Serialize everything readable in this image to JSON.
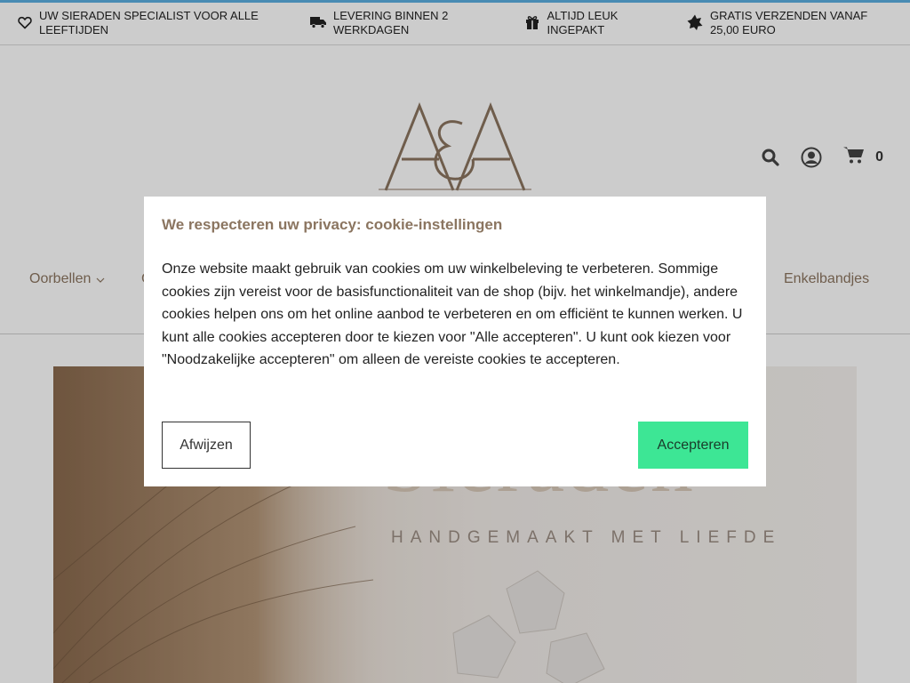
{
  "usp_bar": {
    "items": [
      {
        "icon": "heart-icon",
        "text": "UW SIERADEN SPECIALIST VOOR ALLE LEEFTIJDEN"
      },
      {
        "icon": "truck-icon",
        "text": "LEVERING BINNEN 2 WERKDAGEN"
      },
      {
        "icon": "gift-icon",
        "text": "ALTIJD LEUK INGEPAKT"
      },
      {
        "icon": "star-badge-icon",
        "text": "GRATIS VERZENDEN VANAF 25,00 EURO"
      }
    ]
  },
  "header": {
    "logo_text": "A&A",
    "icons": [
      "search-icon",
      "user-circle-icon",
      "cart-icon"
    ],
    "cart_count": "0"
  },
  "nav": {
    "items": [
      {
        "label": "Oorbellen",
        "has_dropdown": true
      },
      {
        "label": "C",
        "has_dropdown": false
      },
      {
        "label": "Enkelbandjes",
        "has_dropdown": false
      }
    ]
  },
  "hero": {
    "title": "Sieraden",
    "subtitle": "HANDGEMAAKT MET LIEFDE"
  },
  "cookie_modal": {
    "title": "We respecteren uw privacy: cookie-instellingen",
    "body": "Onze website maakt gebruik van cookies om uw winkelbeleving te verbeteren. Sommige cookies zijn vereist voor de basisfunctionaliteit van de shop (bijv. het winkelmandje), andere cookies helpen ons om het online aanbod te verbeteren en om efficiënt te kunnen werken. U kunt alle cookies accepteren door te kiezen voor \"Alle accepteren\". U kunt ook kiezen voor \"Noodzakelijke accepteren\" om alleen de vereiste cookies te accepteren.",
    "decline_label": "Afwijzen",
    "accept_label": "Accepteren"
  },
  "colors": {
    "accent": "#8b7560",
    "accept_button": "#3de695",
    "top_line": "#5aaee0"
  }
}
